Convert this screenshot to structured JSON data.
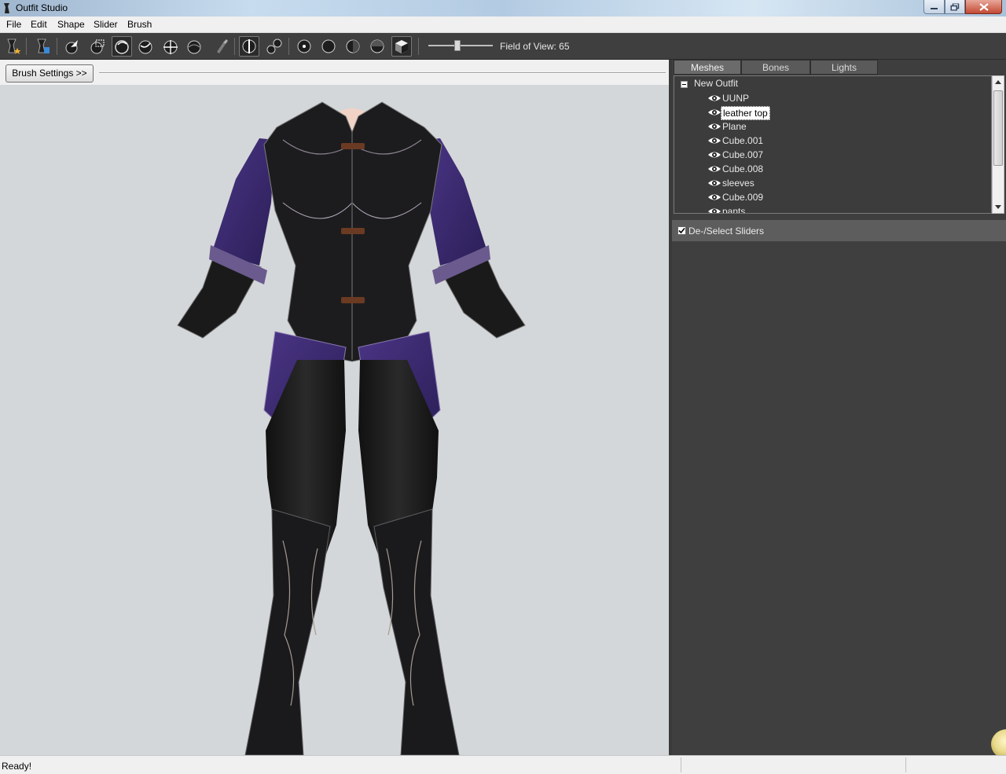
{
  "window": {
    "title": "Outfit Studio"
  },
  "menu": [
    "File",
    "Edit",
    "Shape",
    "Slider",
    "Brush"
  ],
  "toolbar": {
    "fov_label": "Field of View: 65",
    "fov_value": 65
  },
  "brush_settings_label": "Brush Settings >>",
  "tabs": [
    "Meshes",
    "Bones",
    "Lights"
  ],
  "tree": {
    "root": "New Outfit",
    "meshes": [
      "UUNP",
      "leather top",
      "Plane",
      "Cube.001",
      "Cube.007",
      "Cube.008",
      "sleeves",
      "Cube.009",
      "pants"
    ],
    "selected": "leather top"
  },
  "sliders": {
    "select_label": "De-/Select Sliders",
    "checked": true
  },
  "status": {
    "text": "Ready!"
  },
  "colors": {
    "toolbar_bg": "#3f3f3f",
    "panel_bg": "#3e3e3e",
    "viewport_bg": "#d4d7d9",
    "outfit_purple": "#3b2a6e"
  }
}
